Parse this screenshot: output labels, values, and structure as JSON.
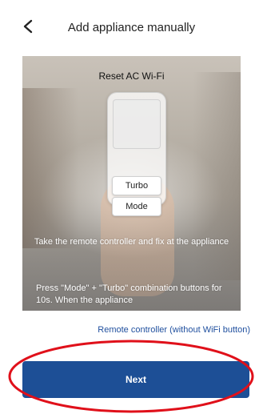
{
  "header": {
    "back_icon": "chevron-left-icon",
    "title": "Add appliance manually"
  },
  "hero": {
    "title": "Reset AC Wi-Fi",
    "remote": {
      "turbo_label": "Turbo",
      "mode_label": "Mode"
    },
    "instruction": "Take the remote controller and fix at the appliance",
    "press_text": "Press \"Mode\" + \"Turbo\" combination buttons for 10s. When the appliance"
  },
  "link": {
    "remote_without_wifi": "Remote controller (without WiFi button)"
  },
  "footer": {
    "next_label": "Next"
  },
  "colors": {
    "primary_button": "#1d4f96",
    "link": "#1f4f9e",
    "annotation_circle": "#e0101a"
  }
}
